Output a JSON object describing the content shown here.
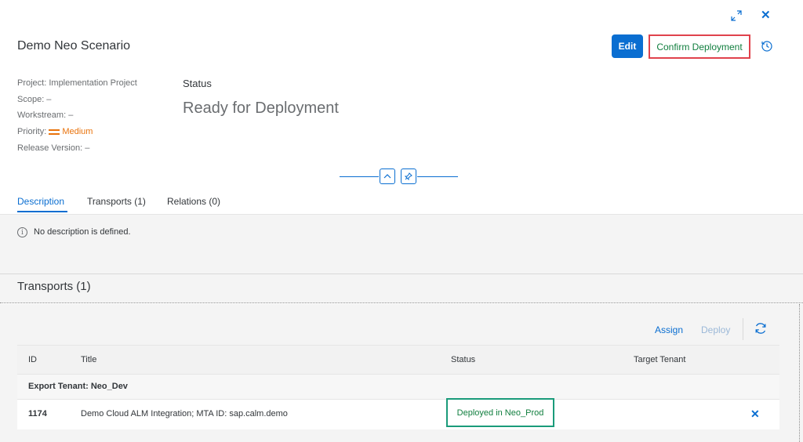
{
  "header": {
    "title": "Demo Neo Scenario",
    "edit_label": "Edit",
    "confirm_label": "Confirm Deployment",
    "close_glyph": "✕"
  },
  "attributes": {
    "project": "Project: Implementation Project",
    "scope": "Scope: –",
    "workstream": "Workstream: –",
    "priority_label": "Priority:",
    "priority_value": "Medium",
    "release": "Release Version: –"
  },
  "status": {
    "label": "Status",
    "value": "Ready for Deployment"
  },
  "tabs": [
    {
      "label": "Description",
      "active": true
    },
    {
      "label": "Transports (1)",
      "active": false
    },
    {
      "label": "Relations (0)",
      "active": false
    }
  ],
  "description": {
    "info_glyph": "i",
    "text": "No description is defined."
  },
  "transports": {
    "title": "Transports (1)",
    "toolbar": {
      "assign": "Assign",
      "deploy": "Deploy"
    },
    "columns": [
      "ID",
      "Title",
      "Status",
      "Target Tenant"
    ],
    "group": "Export Tenant: Neo_Dev",
    "rows": [
      {
        "id": "1174",
        "title": "Demo Cloud ALM Integration; MTA ID: sap.calm.demo",
        "status": "Deployed in Neo_Prod",
        "target": "",
        "remove_glyph": "✕"
      }
    ]
  },
  "colors": {
    "accent": "#0a6ed1",
    "positive": "#107e3e",
    "warning": "#e9730c",
    "highlight_red": "#e0424c",
    "highlight_teal": "#1a9b7a"
  },
  "icons": [
    "expand-icon",
    "close-icon",
    "history-icon",
    "collapse-up-icon",
    "pin-icon",
    "info-icon",
    "refresh-icon",
    "remove-icon"
  ]
}
